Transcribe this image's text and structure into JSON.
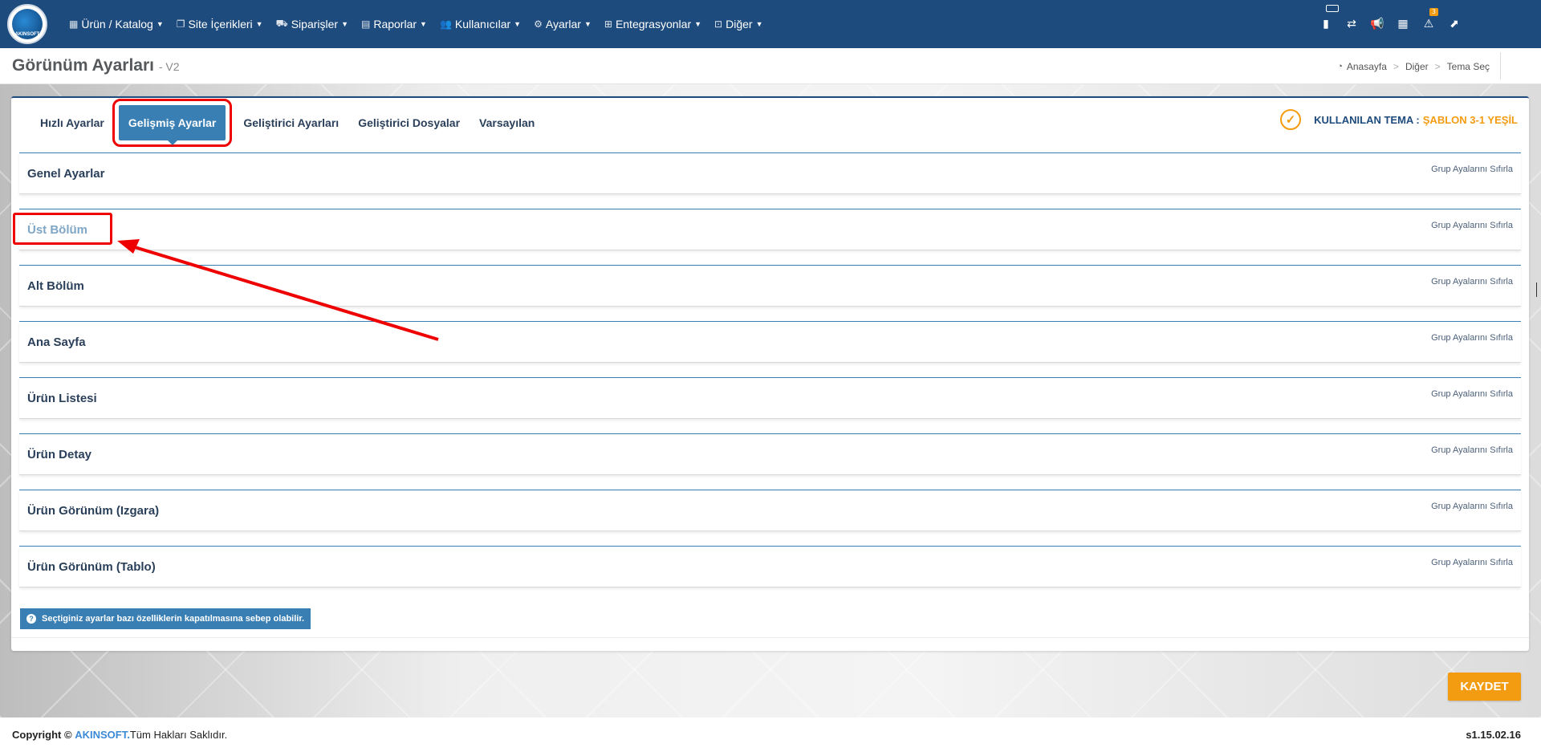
{
  "logo": {
    "text": "AKINSOFT"
  },
  "nav": {
    "items": [
      {
        "label": "Ürün / Katalog",
        "icon": "cubes-icon"
      },
      {
        "label": "Site İçerikleri",
        "icon": "files-icon"
      },
      {
        "label": "Siparişler",
        "icon": "cart-icon"
      },
      {
        "label": "Raporlar",
        "icon": "file-icon"
      },
      {
        "label": "Kullanıcılar",
        "icon": "users-icon"
      },
      {
        "label": "Ayarlar",
        "icon": "gears-icon"
      },
      {
        "label": "Entegrasyonlar",
        "icon": "sitemap-icon"
      },
      {
        "label": "Diğer",
        "icon": "grid-icon"
      }
    ]
  },
  "top_icons": {
    "alert_count": "3"
  },
  "page": {
    "title": "Görünüm Ayarları",
    "subtitle": "- V2"
  },
  "breadcrumb": {
    "items": [
      "Anasayfa",
      "Diğer",
      "Tema Seç"
    ]
  },
  "tabs": [
    {
      "label": "Hızlı Ayarlar",
      "active": false
    },
    {
      "label": "Gelişmiş Ayarlar",
      "active": true
    },
    {
      "label": "Geliştirici Ayarları",
      "active": false
    },
    {
      "label": "Geliştirici Dosyalar",
      "active": false
    },
    {
      "label": "Varsayılan",
      "active": false
    }
  ],
  "theme": {
    "label": "KULLANILAN TEMA :",
    "value": "ŞABLON 3-1 YEŞİL"
  },
  "groups": [
    {
      "title": "Genel Ayarlar",
      "reset": "Grup Ayalarını Sıfırla"
    },
    {
      "title": "Üst Bölüm",
      "reset": "Grup Ayalarını Sıfırla"
    },
    {
      "title": "Alt Bölüm",
      "reset": "Grup Ayalarını Sıfırla"
    },
    {
      "title": "Ana Sayfa",
      "reset": "Grup Ayalarını Sıfırla"
    },
    {
      "title": "Ürün Listesi",
      "reset": "Grup Ayalarını Sıfırla"
    },
    {
      "title": "Ürün Detay",
      "reset": "Grup Ayalarını Sıfırla"
    },
    {
      "title": "Ürün Görünüm (Izgara)",
      "reset": "Grup Ayalarını Sıfırla"
    },
    {
      "title": "Ürün Görünüm (Tablo)",
      "reset": "Grup Ayalarını Sıfırla"
    }
  ],
  "note": "Seçtiginiz ayarlar bazı özelliklerin kapatılmasına sebep olabilir.",
  "save_label": "KAYDET",
  "footer": {
    "copyright_prefix": "Copyright ©",
    "brand": "AKINSOFT.",
    "rights": "Tüm Hakları Saklıdır.",
    "version": "s1.15.02.16"
  },
  "colors": {
    "nav_bg": "#1e4b7d",
    "accent": "#3a7fb3",
    "orange": "#f39c12",
    "highlight": "#e00000"
  }
}
